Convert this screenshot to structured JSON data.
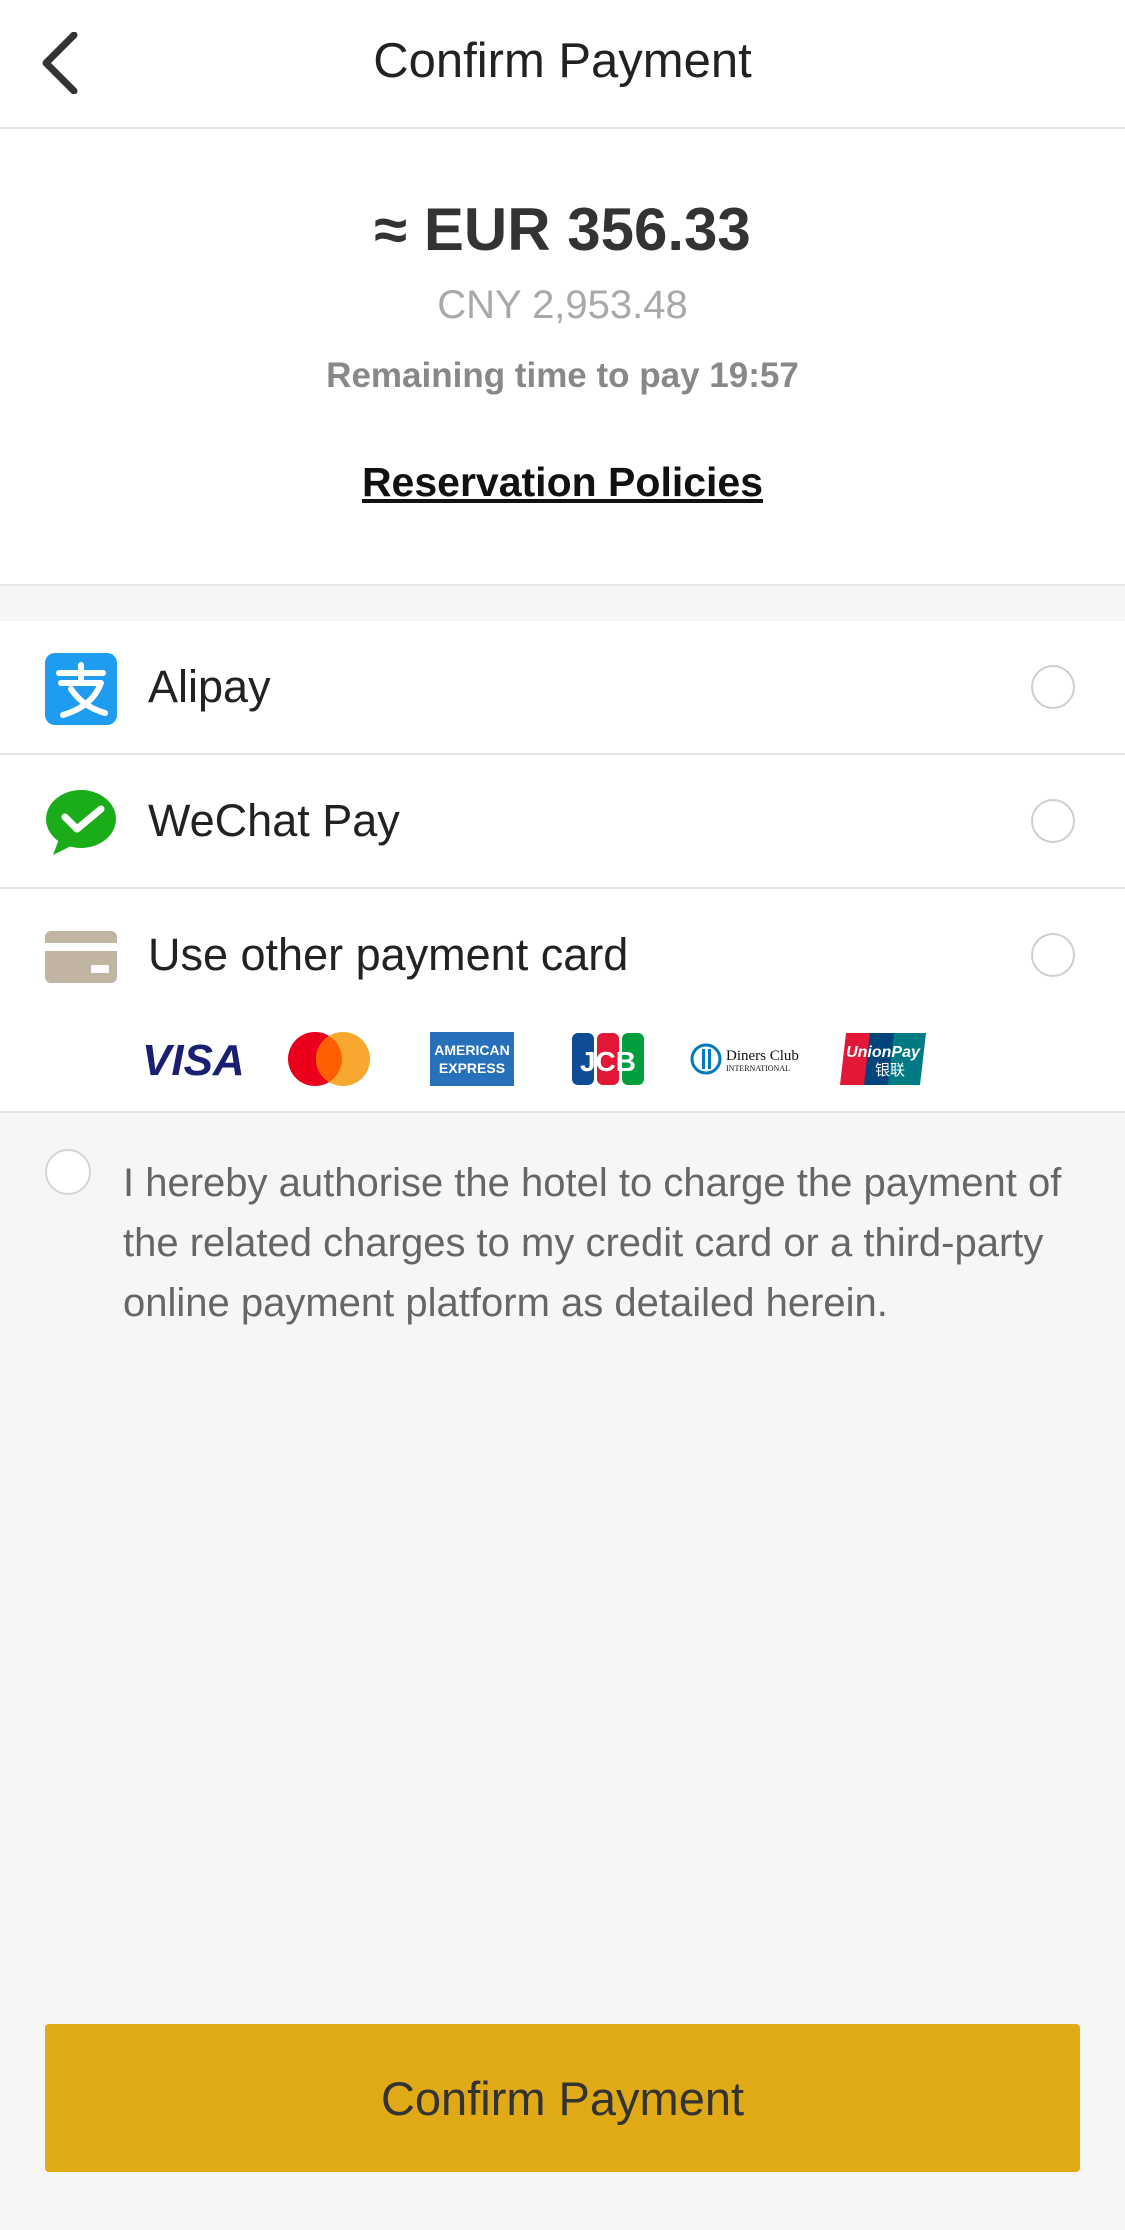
{
  "header": {
    "title": "Confirm Payment",
    "back_icon": "chevron-left-icon"
  },
  "summary": {
    "amount": "≈ EUR 356.33",
    "amount_cny": "CNY 2,953.48",
    "remaining": "Remaining time to pay 19:57",
    "policies_link": "Reservation Policies"
  },
  "payment_methods": [
    {
      "label": "Alipay",
      "icon": "alipay-icon",
      "selected": false
    },
    {
      "label": "WeChat Pay",
      "icon": "wechat-pay-icon",
      "selected": false
    },
    {
      "label": "Use other payment card",
      "icon": "credit-card-icon",
      "selected": false
    }
  ],
  "card_brands": {
    "visa": "VISA",
    "amex_line1": "AMERICAN",
    "amex_line2": "EXPRESS",
    "jcb": "JCB",
    "diners_line1": "Diners Club",
    "diners_line2": "INTERNATIONAL",
    "unionpay_line1": "UnionPay",
    "unionpay_line2": "银联"
  },
  "consent": {
    "text": "I hereby authorise the hotel to charge the payment of the related charges to my credit card or a third-party online payment platform as detailed herein.",
    "checked": false
  },
  "confirm_button": "Confirm Payment",
  "colors": {
    "accent": "#e0aa16",
    "alipay": "#1e9df0",
    "wechat": "#1aad19",
    "card": "#c2b4a3"
  }
}
